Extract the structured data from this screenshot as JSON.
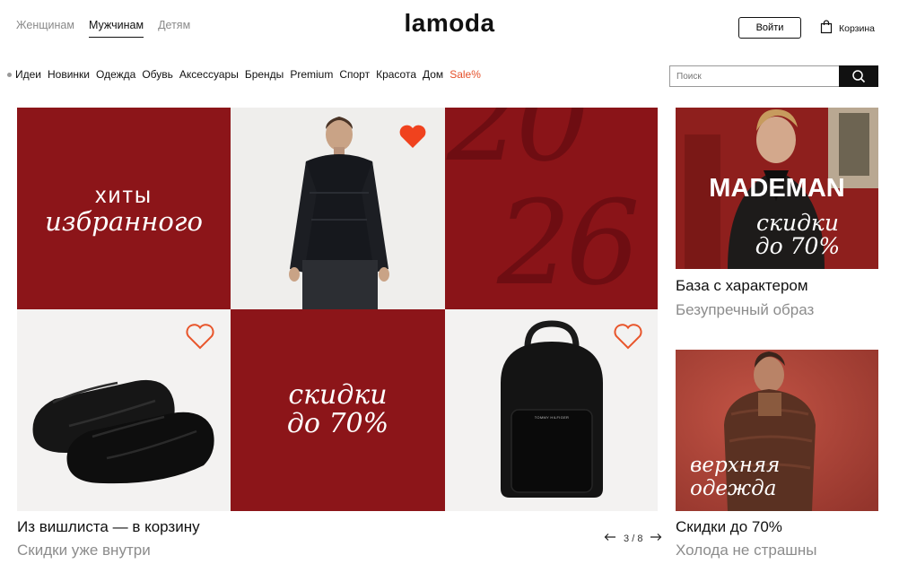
{
  "header": {
    "tabs": [
      {
        "label": "Женщинам",
        "active": false
      },
      {
        "label": "Мужчинам",
        "active": true
      },
      {
        "label": "Детям",
        "active": false
      }
    ],
    "logo": "lamoda",
    "login_label": "Войти",
    "cart_label": "Корзина"
  },
  "nav": {
    "items": [
      "Идеи",
      "Новинки",
      "Одежда",
      "Обувь",
      "Аксессуары",
      "Бренды",
      "Premium",
      "Спорт",
      "Красота",
      "Дом"
    ],
    "sale_label": "Sale%"
  },
  "search": {
    "placeholder": "Поиск",
    "value": ""
  },
  "banner": {
    "tile1_line1": "хиты",
    "tile1_line2": "избранного",
    "year_top": "20",
    "year_bottom": "26",
    "tile_sale_line1": "скидки",
    "tile_sale_line2": "до 70%",
    "bag_brand": "TOMMY HILFIGER",
    "caption_title": "Из вишлиста — в корзину",
    "caption_sub": "Скидки уже внутри",
    "pager_current": "3",
    "pager_sep": "/",
    "pager_total": "8"
  },
  "promo1": {
    "brand": "MADEMAN",
    "line1": "скидки",
    "line2": "до 70%",
    "title": "База с характером",
    "sub": "Безупречный образ"
  },
  "promo2": {
    "line1": "верхняя",
    "line2": "одежда",
    "title": "Скидки до 70%",
    "sub": "Холода не страшны"
  },
  "colors": {
    "brand_red": "#8c1519",
    "sale_orange": "#e5502a",
    "heart_filled": "#f0421e",
    "heart_outline": "#e8562c"
  }
}
